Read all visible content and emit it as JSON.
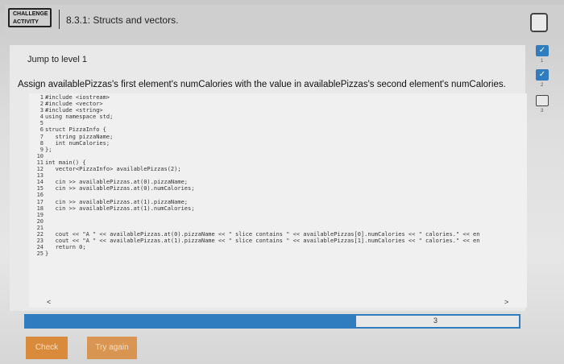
{
  "header": {
    "badge_line1": "CHALLENGE",
    "badge_line2": "ACTIVITY",
    "title": "8.3.1: Structs and vectors."
  },
  "jump": "Jump to level 1",
  "prompt": "Assign availablePizzas's first element's numCalories with the value in availablePizzas's second element's numCalories.",
  "code_lines": [
    "#include <iostream>",
    "#include <vector>",
    "#include <string>",
    "using namespace std;",
    "",
    "struct PizzaInfo {",
    "   string pizzaName;",
    "   int numCalories;",
    "};",
    "",
    "int main() {",
    "   vector<PizzaInfo> availablePizzas(2);",
    "",
    "   cin >> availablePizzas.at(0).pizzaName;",
    "   cin >> availablePizzas.at(0).numCalories;",
    "",
    "   cin >> availablePizzas.at(1).pizzaName;",
    "   cin >> availablePizzas.at(1).numCalories;",
    "",
    "",
    "",
    "   cout << \"A \" << availablePizzas.at(0).pizzaName << \" slice contains \" << availablePizzas[0].numCalories << \" calories.\" << en",
    "   cout << \"A \" << availablePizzas.at(1).pizzaName << \" slice contains \" << availablePizzas[1].numCalories << \" calories.\" << en",
    "   return 0;",
    "}"
  ],
  "line_numbers": [
    "1",
    "2",
    "3",
    "4",
    "5",
    "6",
    "7",
    "8",
    "9",
    "10",
    "11",
    "12",
    "13",
    "14",
    "15",
    "16",
    "17",
    "18",
    "19",
    "20",
    "21",
    "22",
    "23",
    "24",
    "25"
  ],
  "scroll_left": "<",
  "scroll_right": ">",
  "progress": {
    "value": "3"
  },
  "buttons": {
    "check": "Check",
    "try_again": "Try again"
  },
  "levels": [
    {
      "num": "1",
      "status": "done",
      "glyph": "✓"
    },
    {
      "num": "2",
      "status": "done",
      "glyph": "✓"
    },
    {
      "num": "3",
      "status": "open",
      "glyph": ""
    }
  ],
  "colors": {
    "accent": "#2f7dbe",
    "button": "#d98a3a"
  }
}
